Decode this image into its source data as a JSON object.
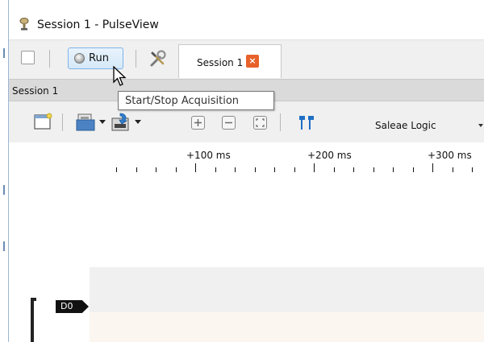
{
  "window": {
    "title": "Session 1 - PulseView"
  },
  "toolbar": {
    "run_label": "Run",
    "tab_label": "Session 1",
    "tab_close_icon": "close-icon"
  },
  "session_bar": {
    "label": "Session 1",
    "tooltip": "Start/Stop Acquisition"
  },
  "toolbar2": {
    "device": "Saleae Logic",
    "icons": [
      "new-view-icon",
      "open-icon",
      "save-icon",
      "zoom-in-icon",
      "zoom-out-icon",
      "zoom-fit-icon",
      "cursor-markers-icon"
    ]
  },
  "ruler": {
    "labels": [
      "+100 ms",
      "+200 ms",
      "+300 ms"
    ]
  },
  "channels": [
    {
      "name": "D0"
    }
  ],
  "colors": {
    "run_button": "#d5e8f8",
    "tab_close": "#e8612a",
    "marker_icon": "#1f6fc5"
  }
}
